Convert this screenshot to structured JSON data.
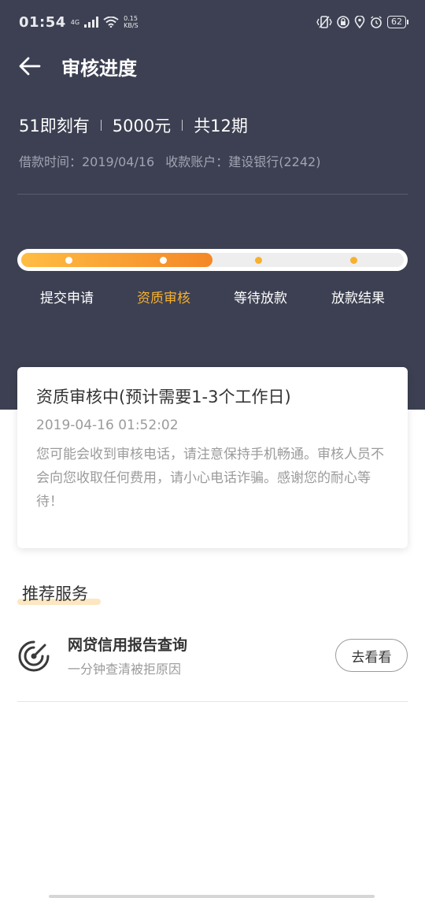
{
  "status_bar": {
    "time": "01:54",
    "net_type": "4G",
    "speed_value": "0.15",
    "speed_unit": "KB/S",
    "battery": "62"
  },
  "app_bar": {
    "title": "审核进度"
  },
  "loan": {
    "product": "51即刻有",
    "amount": "5000元",
    "periods": "共12期",
    "borrow_time": "借款时间：2019/04/16",
    "account": "收款账户：建设银行(2242)"
  },
  "progress": {
    "fraction": 0.5,
    "steps": [
      {
        "label": "提交申请",
        "state": "done"
      },
      {
        "label": "资质审核",
        "state": "current"
      },
      {
        "label": "等待放款",
        "state": "pending"
      },
      {
        "label": "放款结果",
        "state": "pending"
      }
    ]
  },
  "status_card": {
    "title": "资质审核中(预计需要1-3个工作日)",
    "time": "2019-04-16 01:52:02",
    "message": "您可能会收到审核电话，请注意保持手机畅通。审核人员不会向您收取任何费用，请小心电话诈骗。感谢您的耐心等待！"
  },
  "recommend": {
    "section_title": "推荐服务",
    "service_title": "网贷信用报告查询",
    "service_sub": "一分钟查清被拒原因",
    "button_label": "去看看"
  },
  "colors": {
    "header_bg": "#3c4052",
    "accent": "#f7b12f",
    "progress_start": "#ffbd43",
    "progress_end": "#f48726"
  }
}
